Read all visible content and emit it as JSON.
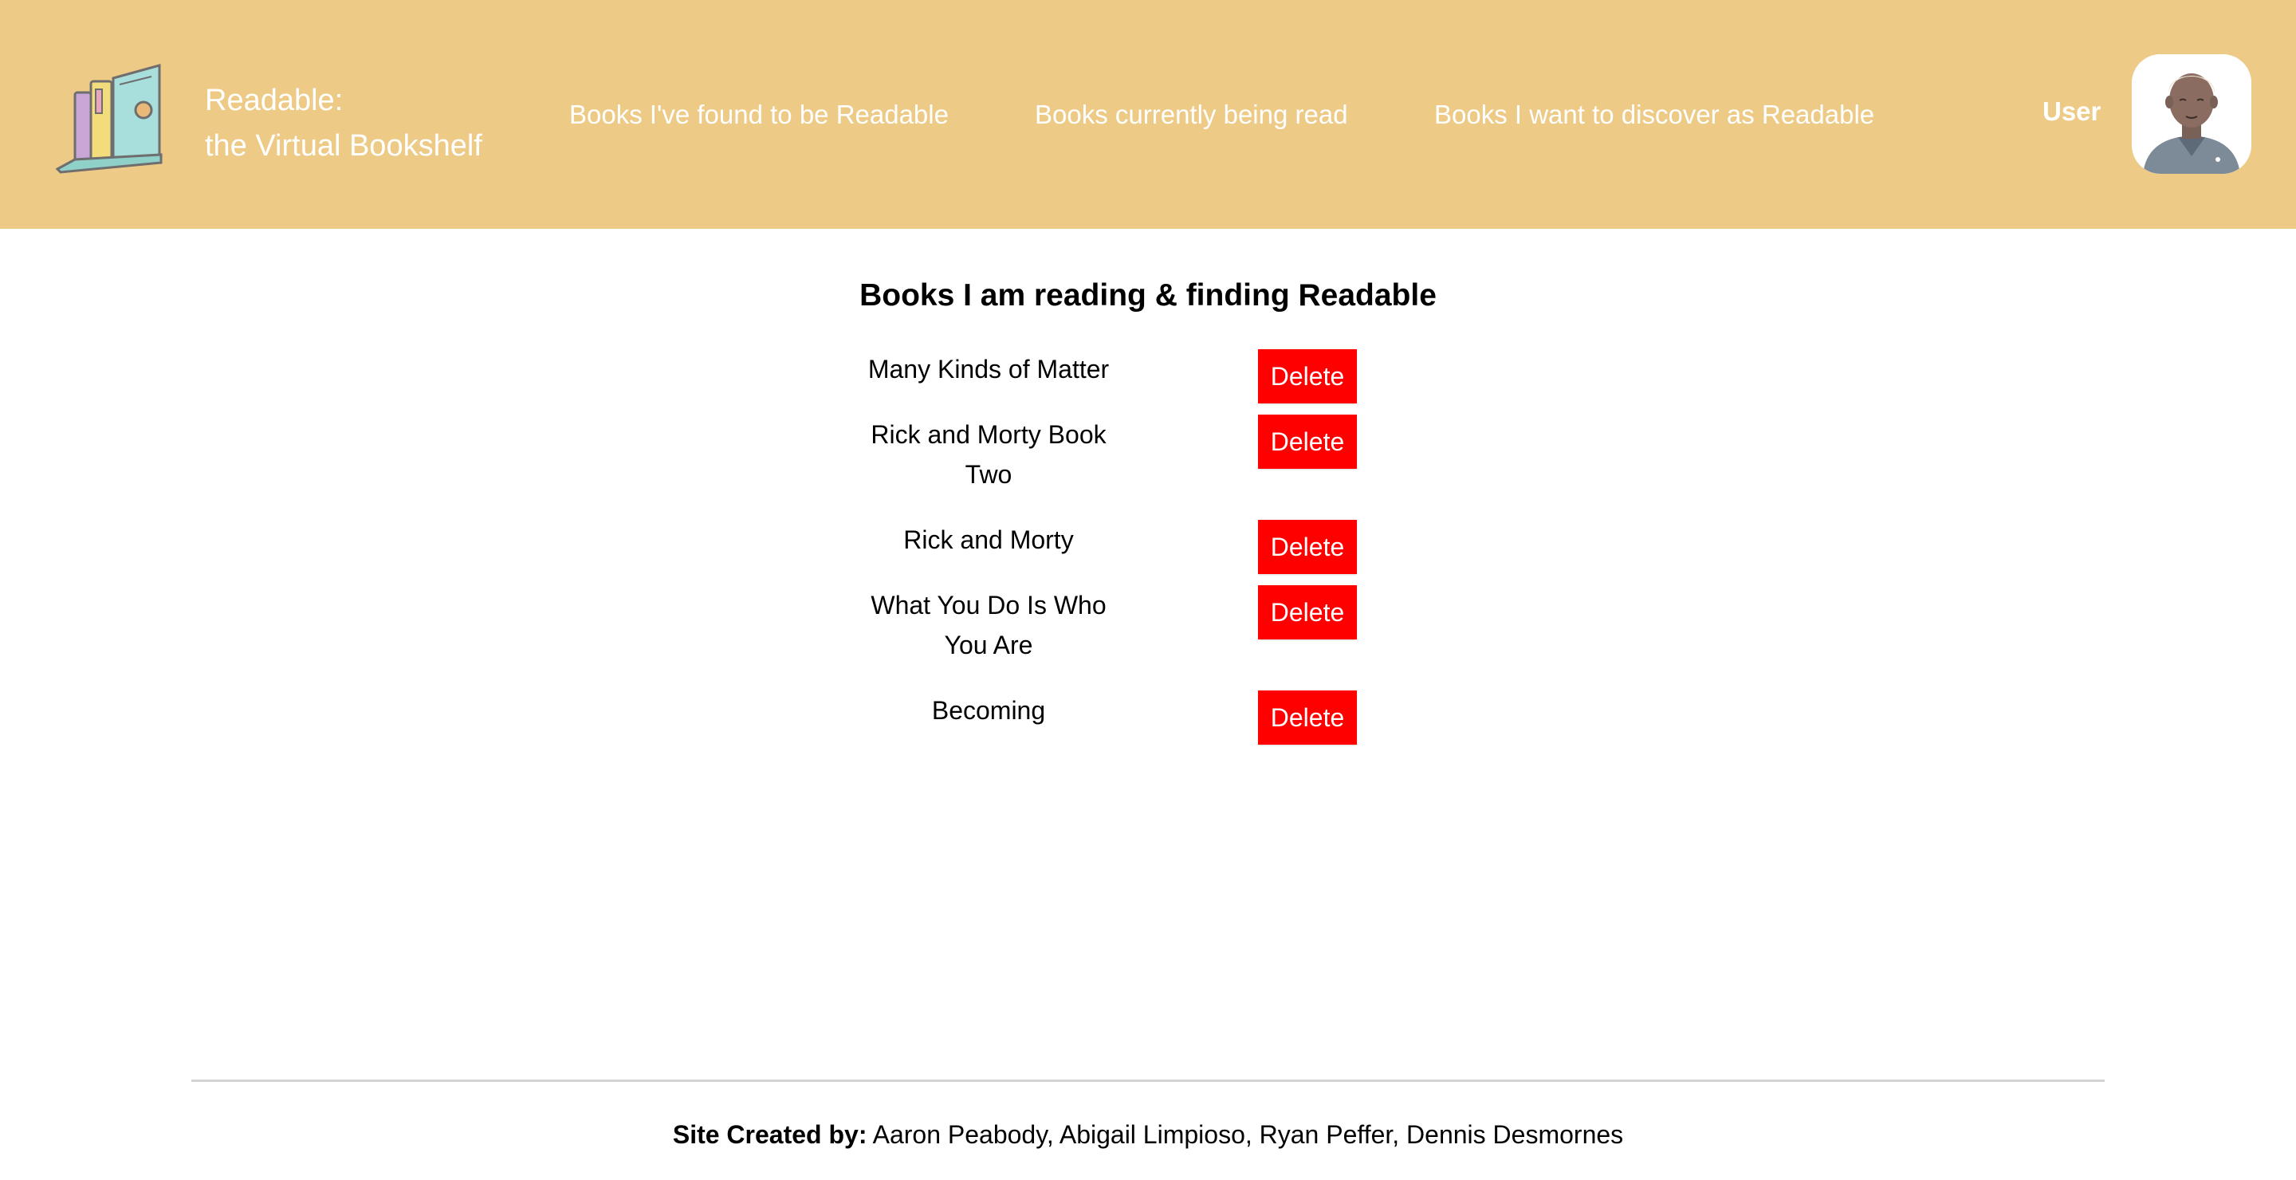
{
  "header": {
    "brand_line1": "Readable:",
    "brand_line2": "the Virtual Bookshelf",
    "logo_icon": "bookshelf-icon",
    "nav": [
      {
        "label": "Books I've found to be Readable"
      },
      {
        "label": "Books currently being read"
      },
      {
        "label": "Books I want to discover as Readable"
      }
    ],
    "user_label": "User",
    "avatar_icon": "user-avatar-icon"
  },
  "main": {
    "title": "Books I am reading & finding Readable",
    "books": [
      {
        "title": "Many Kinds of Matter",
        "action": "Delete"
      },
      {
        "title": "Rick and Morty Book Two",
        "action": "Delete"
      },
      {
        "title": "Rick and Morty",
        "action": "Delete"
      },
      {
        "title": "What You Do Is Who You Are",
        "action": "Delete"
      },
      {
        "title": "Becoming",
        "action": "Delete"
      }
    ]
  },
  "footer": {
    "credit_label": "Site Created by:",
    "credit_names": "Aaron Peabody, Abigail Limpioso, Ryan Peffer, Dennis Desmornes"
  },
  "colors": {
    "header_bg": "#edcb87",
    "delete_button": "#fe0000",
    "header_text": "#ffffff"
  }
}
